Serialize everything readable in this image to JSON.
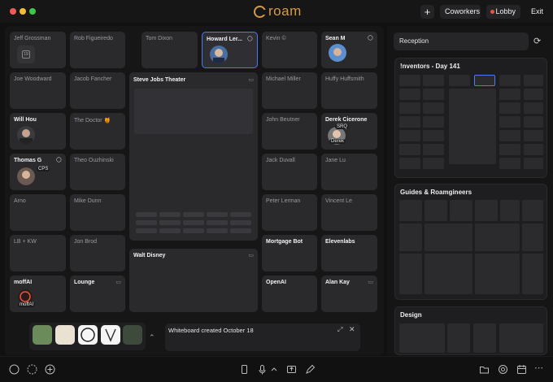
{
  "app": {
    "logo_text": "roam"
  },
  "titlebar": {
    "plus_label": "+",
    "coworkers_label": "Coworkers",
    "lobby_label": "Lobby",
    "exit_label": "Exit",
    "lobby_dot_color": "#e8553b"
  },
  "rooms": {
    "jeff": "Jeff Grossman",
    "rob": "Rob Figueiredo",
    "tom": "Tom Dixon",
    "howard": "Howard Ler...",
    "kevin": "Kevin ©",
    "sean": "Sean M",
    "huffy": "Huffy Huffsmith",
    "joe": "Joe Woodward",
    "jacob": "Jacob Fancher",
    "theater": "Steve Jobs Theater",
    "michael": "Michael Miller",
    "will": "Will Hou",
    "doctor": "The Doctor 🍯",
    "john": "John Beutner",
    "derek": "Derek Cicerone",
    "thomas": "Thomas G",
    "theo": "Theo Ouzhinski",
    "jack": "Jack Duvall",
    "jane": "Jane Lu",
    "arno": "Arno",
    "mike": "Mike Dunn",
    "peter": "Peter Lerman",
    "vincent": "Vincent Le",
    "lbkw": "LB + KW",
    "jon": "Jon Brod",
    "walt": "Walt Disney",
    "mortgage": "Mortgage Bot",
    "elevenlabs": "Elevenlabs",
    "moffai": "moffAI",
    "lounge": "Lounge",
    "openai": "OpenAI",
    "alan": "Alan Kay"
  },
  "tags": {
    "cps": "CPS",
    "srq": "SRQ",
    "derek": "Derek",
    "moffai": "moffAI"
  },
  "calendar_day": "19",
  "whiteboard": {
    "text": "Whiteboard created October 18"
  },
  "right_panel": {
    "reception": "Reception",
    "floors": [
      {
        "title": "!nventors - Day 141"
      },
      {
        "title": "Guides & Roamgineers"
      },
      {
        "title": "Design"
      }
    ]
  },
  "colors": {
    "accent": "#d79a47",
    "select": "#4a7cf0",
    "record": "#e8553b"
  }
}
